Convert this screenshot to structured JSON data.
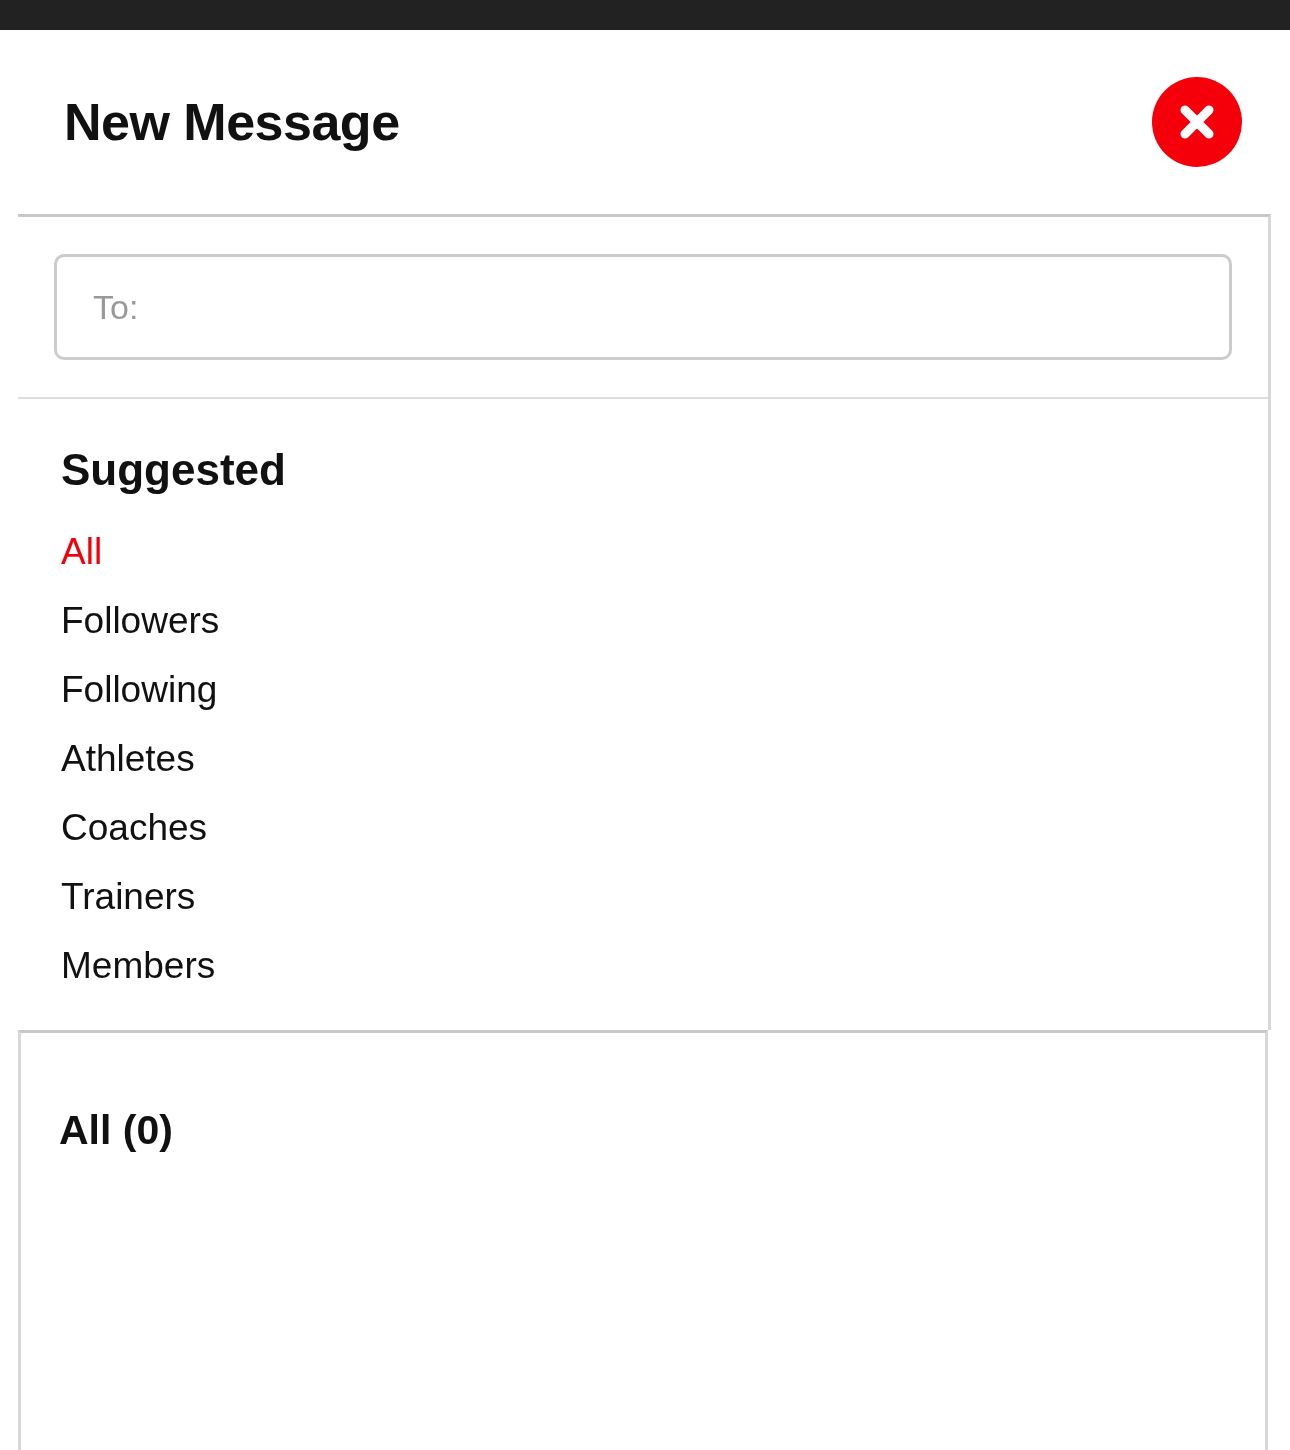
{
  "header": {
    "title": "New Message"
  },
  "to_field": {
    "placeholder": "To:"
  },
  "suggested": {
    "title": "Suggested",
    "items": [
      {
        "label": "All",
        "selected": true
      },
      {
        "label": "Followers",
        "selected": false
      },
      {
        "label": "Following",
        "selected": false
      },
      {
        "label": "Athletes",
        "selected": false
      },
      {
        "label": "Coaches",
        "selected": false
      },
      {
        "label": "Trainers",
        "selected": false
      },
      {
        "label": "Members",
        "selected": false
      }
    ]
  },
  "results": {
    "title": "All (0)"
  }
}
